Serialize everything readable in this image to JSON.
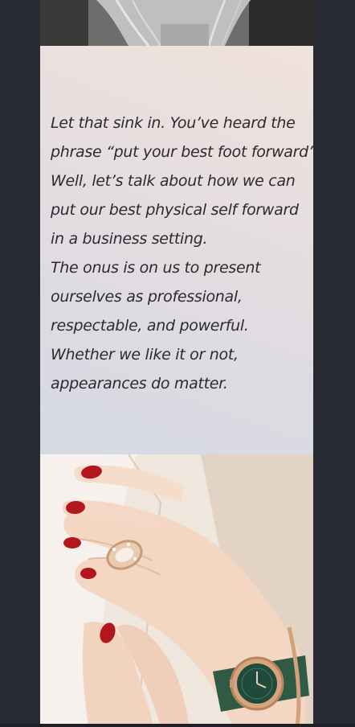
{
  "article": {
    "paragraph_lines": [
      "Let that sink in. You’ve heard the",
      "phrase “put your best foot forward”.",
      "Well, let’s talk about how we can",
      "put our best physical self forward",
      "in a business setting.",
      "The onus is on us to present",
      "ourselves as professional,",
      "respectable, and powerful.",
      "Whether we like it or not,",
      "appearances do matter."
    ]
  },
  "colors": {
    "page_background": "#272a33",
    "panel_gradient_top": "#f0e2dc",
    "panel_gradient_bottom": "#d5d9e4",
    "text": "#2c2a30",
    "nail_polish": "#b3161c",
    "watch_dial": "#1f4a3c"
  }
}
